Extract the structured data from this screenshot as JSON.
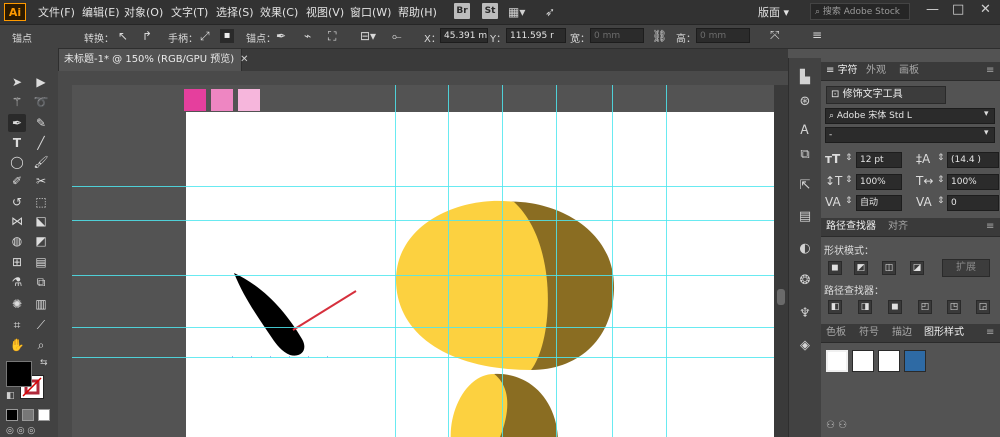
{
  "app": {
    "logo": "Ai"
  },
  "menu": [
    "文件(F)",
    "编辑(E)",
    "对象(O)",
    "文字(T)",
    "选择(S)",
    "效果(C)",
    "视图(V)",
    "窗口(W)",
    "帮助(H)"
  ],
  "bridge_buttons": [
    "Br",
    "St"
  ],
  "workspace": "版面",
  "stock_search": {
    "placeholder": "搜索 Adobe Stock"
  },
  "window_controls": [
    "—",
    "□",
    "✕"
  ],
  "control_bar": {
    "anchor_label": "锚点",
    "convert_label": "转换：",
    "handles_label": "手柄：",
    "anchors_label": "锚点：",
    "x_label": "X：",
    "x_value": "45.391 m",
    "y_label": "Y：",
    "y_value": "111.595 r",
    "w_label": "宽：",
    "w_value": "0 mm",
    "h_label": "高：",
    "h_value": "0 mm"
  },
  "document_tab": {
    "title": "未标题-1* @ 150% (RGB/GPU 预览)",
    "close": "✕"
  },
  "swatch_colors": [
    "#e53f9d",
    "#ee86c2",
    "#f6b6dc"
  ],
  "colors": {
    "body": "#fcd140",
    "shade": "#8a6d22",
    "leaf": "#000000",
    "line": "#d6303d",
    "guide": "#4fe6ee",
    "fill_swatch": "#000000",
    "stroke_swatch": "#b0283a"
  },
  "tools": [
    "selection-icon",
    "direct-selection-icon",
    "magic-wand-icon",
    "lasso-icon",
    "pen-icon",
    "curvature-icon",
    "type-icon",
    "line-segment-icon",
    "ellipse-icon",
    "paintbrush-icon",
    "shaper-icon",
    "scissors-icon",
    "rotate-icon",
    "scale-icon",
    "width-icon",
    "free-transform-icon",
    "shape-builder-icon",
    "perspective-grid-icon",
    "mesh-icon",
    "gradient-icon",
    "eyedropper-icon",
    "blend-icon",
    "symbol-sprayer-icon",
    "column-graph-icon",
    "artboard-icon",
    "slice-icon",
    "hand-icon",
    "zoom-icon"
  ],
  "panels": {
    "character": {
      "tabs": [
        "字符",
        "外观",
        "画板"
      ],
      "touch_type": "修饰文字工具",
      "font_name": "Adobe 宋体 Std L",
      "font_style": "-",
      "size": "12 pt",
      "leading": "(14.4 )",
      "vscale": "100%",
      "hscale": "100%",
      "kerning": "自动",
      "tracking": "0"
    },
    "pathfinder": {
      "tabs": [
        "路径查找器",
        "对齐"
      ],
      "shape_modes": "形状模式：",
      "expand": "扩展",
      "pathfinders": "路径查找器："
    },
    "bottom": {
      "tabs": [
        "色板",
        "符号",
        "描边",
        "图形样式"
      ]
    }
  }
}
